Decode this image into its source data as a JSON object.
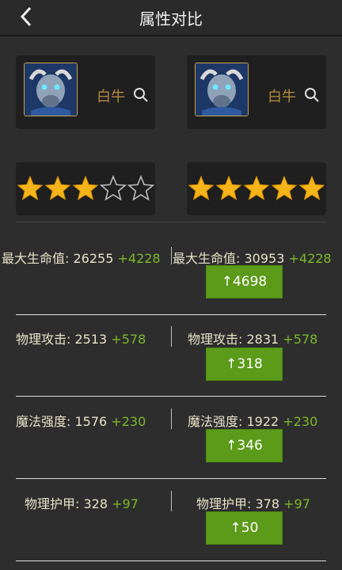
{
  "header": {
    "title": "属性对比"
  },
  "colors": {
    "accent_green": "#5c9a1a",
    "bonus_green": "#7bb82a",
    "name_gold": "#b38a3e"
  },
  "left": {
    "hero_name": "白牛",
    "stars_filled": 3,
    "stars_total": 5
  },
  "right": {
    "hero_name": "白牛",
    "stars_filled": 5,
    "stars_total": 5
  },
  "stats": [
    {
      "label": "最大生命值: ",
      "left_value": "26255",
      "left_bonus": "+4228",
      "right_value": "30953",
      "right_bonus": "+4228",
      "diff": "↑4698"
    },
    {
      "label": "物理攻击: ",
      "left_value": "2513",
      "left_bonus": "+578",
      "right_value": "2831",
      "right_bonus": "+578",
      "diff": "↑318"
    },
    {
      "label": "魔法强度: ",
      "left_value": "1576",
      "left_bonus": "+230",
      "right_value": "1922",
      "right_bonus": "+230",
      "diff": "↑346"
    },
    {
      "label": "物理护甲: ",
      "left_value": "328",
      "left_bonus": "+97",
      "right_value": "378",
      "right_bonus": "+97",
      "diff": "↑50"
    }
  ]
}
